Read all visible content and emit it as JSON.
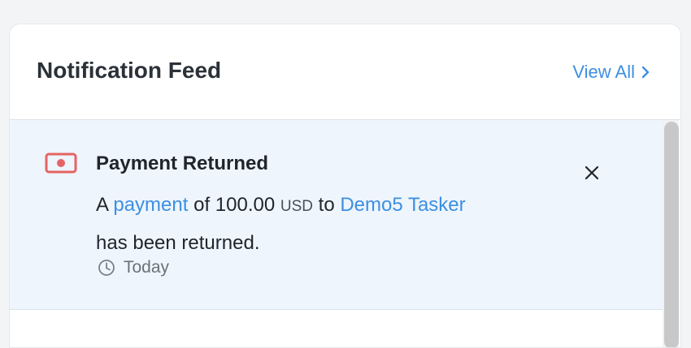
{
  "header": {
    "title": "Notification Feed",
    "view_all_label": "View All"
  },
  "notifications": [
    {
      "icon": "money-bill-icon",
      "icon_color": "#e46464",
      "title": "Payment Returned",
      "body": {
        "prefix": "A",
        "link_payment": "payment",
        "middle": "of 100.00",
        "currency": "USD",
        "to": "to",
        "link_recipient": "Demo5 Tasker",
        "suffix": "has been returned."
      },
      "time": "Today"
    }
  ],
  "colors": {
    "accent": "#3d8fe0",
    "notification_bg": "#eef5fd"
  }
}
